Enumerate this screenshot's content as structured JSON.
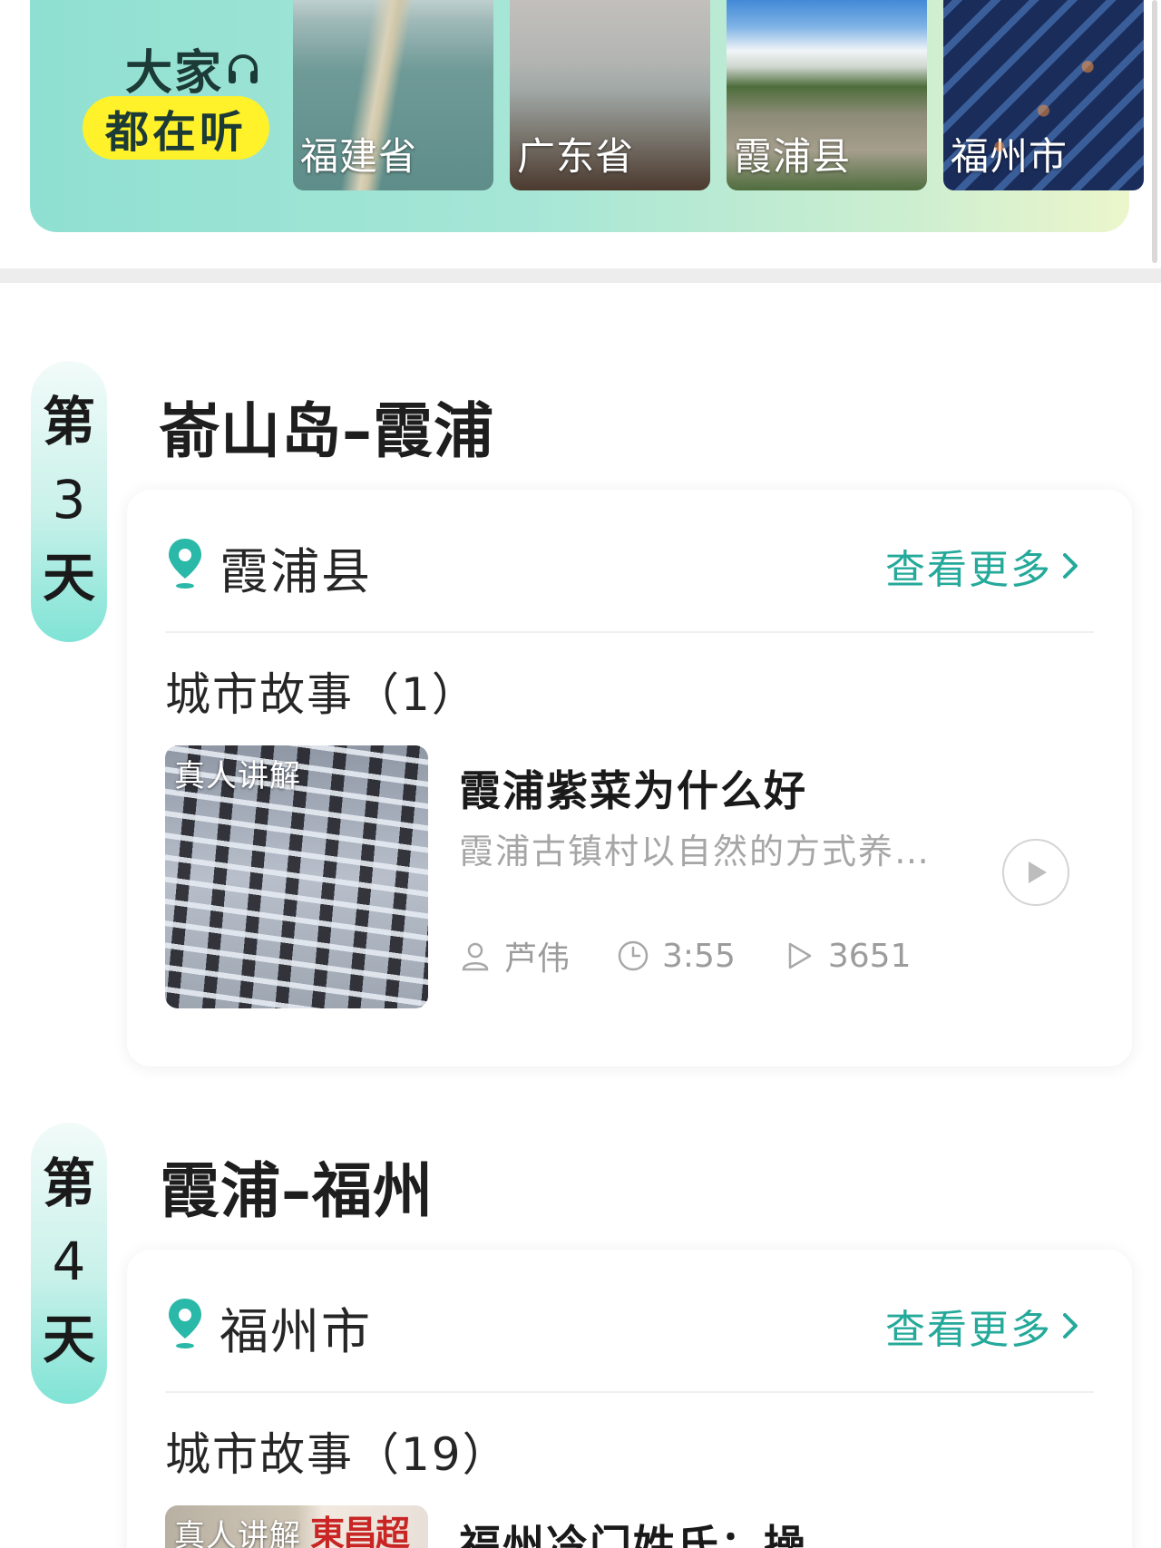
{
  "banner": {
    "title_line1": "大家",
    "title_pill": "都在听",
    "tiles": [
      {
        "label": "福建省"
      },
      {
        "label": "广东省"
      },
      {
        "label": "霞浦县"
      },
      {
        "label": "福州市"
      }
    ]
  },
  "days": [
    {
      "day_prefix": "第",
      "day_number": "3",
      "day_suffix": "天",
      "route": "嵛山岛–霞浦",
      "city": "霞浦县",
      "more_label": "查看更多",
      "section_label": "城市故事（1）",
      "story": {
        "badge": "真人讲解",
        "title": "霞浦紫菜为什么好",
        "description": "霞浦古镇村以自然的方式养…",
        "narrator": "芦伟",
        "duration": "3:55",
        "plays": "3651"
      }
    },
    {
      "day_prefix": "第",
      "day_number": "4",
      "day_suffix": "天",
      "route": "霞浦–福州",
      "city": "福州市",
      "more_label": "查看更多",
      "section_label": "城市故事（19）",
      "story": {
        "badge": "真人讲解",
        "thumb_text": "東昌超鈴",
        "title": "福州冷门姓氏：操"
      }
    }
  ],
  "colors": {
    "accent": "#24a99a",
    "pill": "#fff12a",
    "tab_bottom": "#7fe3d5"
  }
}
